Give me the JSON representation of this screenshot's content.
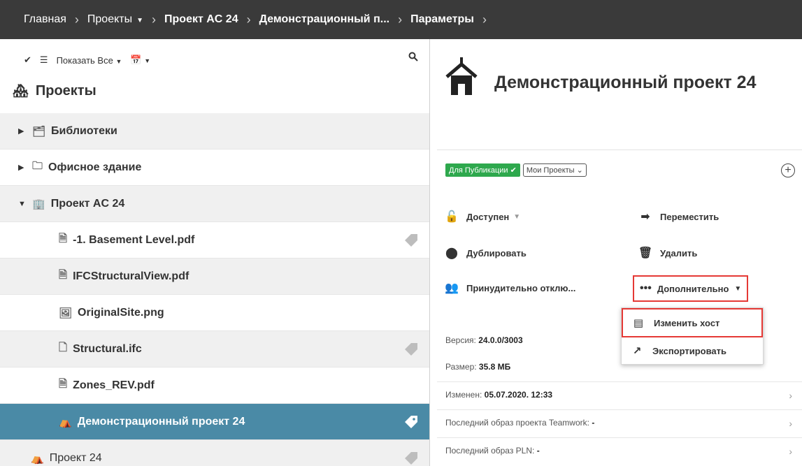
{
  "breadcrumb": {
    "home": "Главная",
    "projects": "Проекты",
    "project": "Проект AC 24",
    "demo": "Демонстрационный п...",
    "params": "Параметры",
    "separator": "›"
  },
  "toolbar": {
    "show_all": "Показать Все"
  },
  "tree": {
    "header": "Проекты",
    "rows": [
      {
        "label": "Библиотеки"
      },
      {
        "label": "Офисное здание"
      },
      {
        "label": "Проект AC 24"
      },
      {
        "label": "-1. Basement Level.pdf"
      },
      {
        "label": "IFCStructuralView.pdf"
      },
      {
        "label": "OriginalSite.png"
      },
      {
        "label": "Structural.ifc"
      },
      {
        "label": "Zones_REV.pdf"
      },
      {
        "label": "Демонстрационный проект 24"
      },
      {
        "label": "Проект 24"
      }
    ]
  },
  "detail": {
    "title": "Демонстрационный проект 24",
    "status_chip": "Для Публикации",
    "filter_chip": "Мои Проекты",
    "actions": {
      "available": "Доступен",
      "move": "Переместить",
      "duplicate": "Дублировать",
      "delete": "Удалить",
      "force": "Принудительно отклю...",
      "more": "Дополнительно"
    },
    "menu": {
      "change_host": "Изменить хост",
      "export": "Экспортировать"
    },
    "info": {
      "version_label": "Версия:",
      "version": "24.0.0/3003",
      "size_label": "Размер:",
      "size": "35.8 МБ",
      "modified_label": "Изменен:",
      "modified": "05.07.2020. 12:33",
      "teamwork_label": "Последний образ проекта Teamwork:",
      "teamwork": "-",
      "pln_label": "Последний образ PLN:",
      "pln": "-"
    }
  },
  "colors": {
    "topbar": "#3a3a3a",
    "selected_row": "#4a8aa6",
    "green_chip": "#2ea84d",
    "highlight": "#e53935"
  }
}
